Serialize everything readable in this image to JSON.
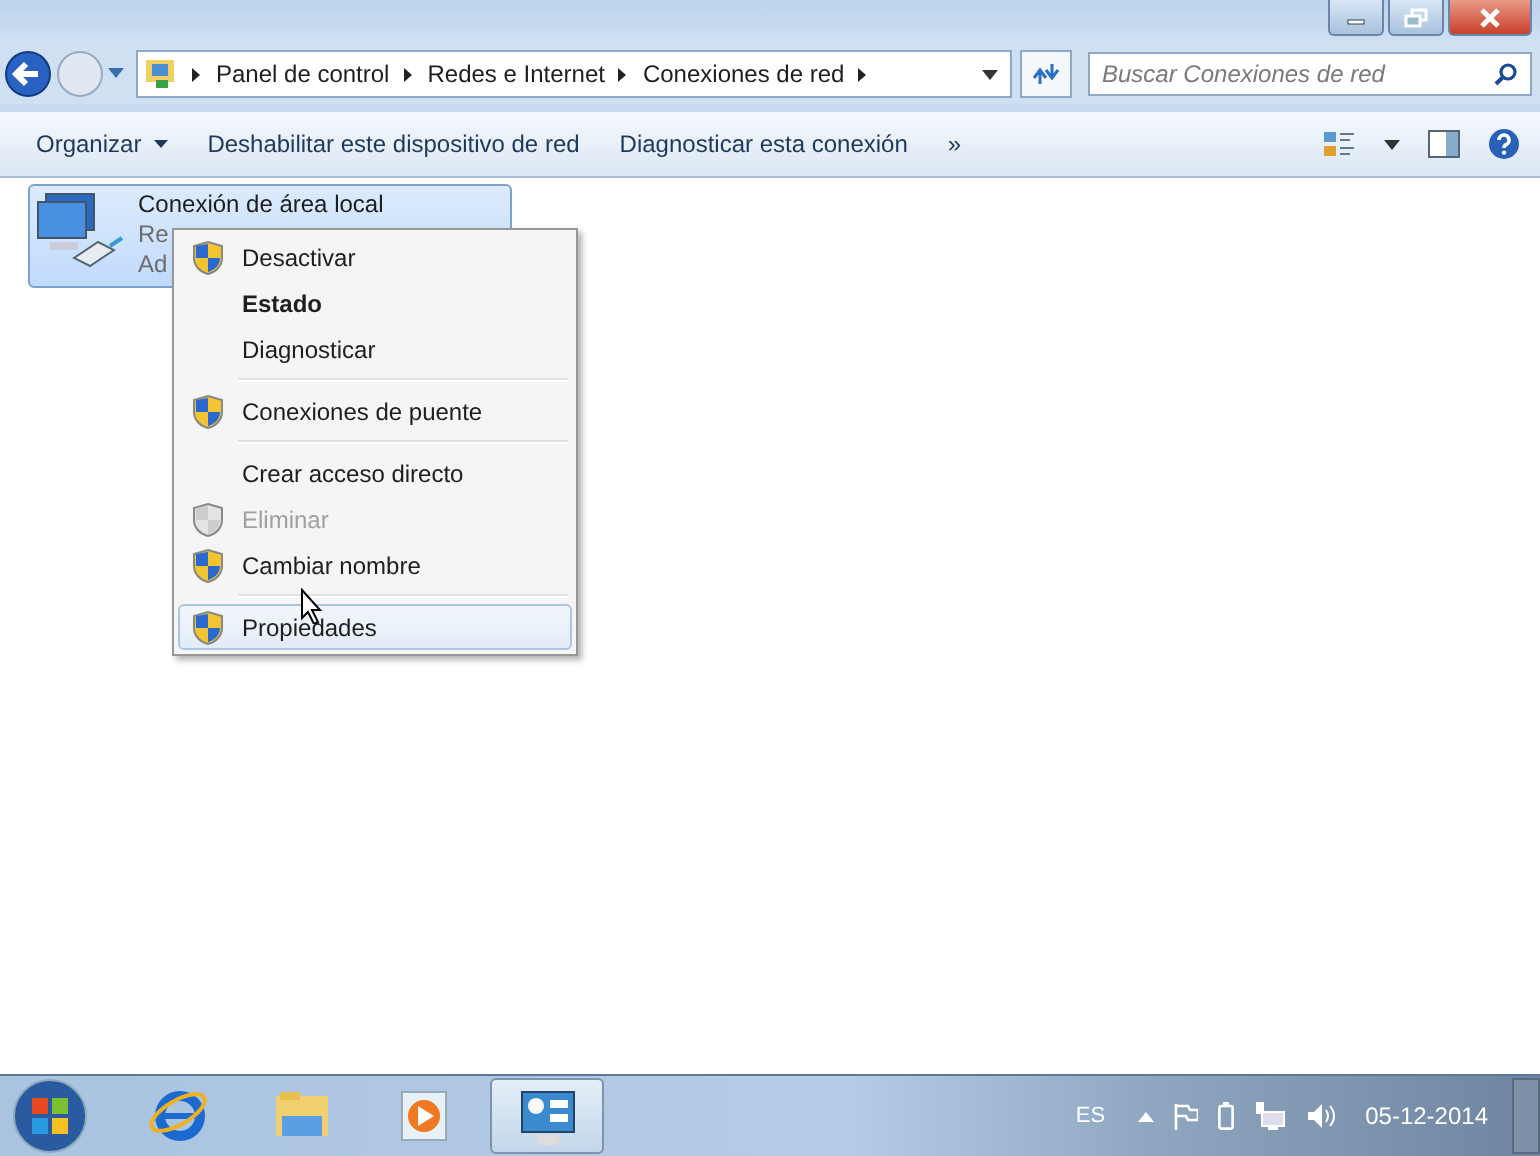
{
  "address_bar": {
    "breadcrumbs": [
      "Panel de control",
      "Redes e Internet",
      "Conexiones de red"
    ]
  },
  "search": {
    "placeholder": "Buscar Conexiones de red"
  },
  "toolbar": {
    "items": [
      {
        "label": "Organizar",
        "dropdown": true
      },
      {
        "label": "Deshabilitar este dispositivo de red",
        "dropdown": false
      },
      {
        "label": "Diagnosticar esta conexión",
        "dropdown": false
      },
      {
        "label": "»",
        "dropdown": false
      }
    ]
  },
  "files": [
    {
      "name": "Conexión de área local",
      "lines": [
        "Re",
        "Ad"
      ],
      "selected": true
    }
  ],
  "context_menu": {
    "items": [
      {
        "kind": "item",
        "label": "Desactivar",
        "shield": true,
        "bold": false,
        "disabled": false,
        "selected": false
      },
      {
        "kind": "item",
        "label": "Estado",
        "shield": false,
        "bold": true,
        "disabled": false,
        "selected": false
      },
      {
        "kind": "item",
        "label": "Diagnosticar",
        "shield": false,
        "bold": false,
        "disabled": false,
        "selected": false
      },
      {
        "kind": "separator"
      },
      {
        "kind": "item",
        "label": "Conexiones de puente",
        "shield": true,
        "bold": false,
        "disabled": false,
        "selected": false
      },
      {
        "kind": "separator"
      },
      {
        "kind": "item",
        "label": "Crear acceso directo",
        "shield": false,
        "bold": false,
        "disabled": false,
        "selected": false
      },
      {
        "kind": "item",
        "label": "Eliminar",
        "shield": true,
        "bold": false,
        "disabled": true,
        "selected": false
      },
      {
        "kind": "item",
        "label": "Cambiar nombre",
        "shield": true,
        "bold": false,
        "disabled": false,
        "selected": false
      },
      {
        "kind": "separator"
      },
      {
        "kind": "item",
        "label": "Propiedades",
        "shield": true,
        "bold": false,
        "disabled": false,
        "selected": true
      }
    ]
  },
  "taskbar": {
    "apps": [
      {
        "kind": "browser",
        "selected": false
      },
      {
        "kind": "folder",
        "selected": false
      },
      {
        "kind": "media",
        "selected": false
      },
      {
        "kind": "control-panel",
        "selected": true
      }
    ],
    "language": "ES",
    "date": "05-12-2014"
  }
}
